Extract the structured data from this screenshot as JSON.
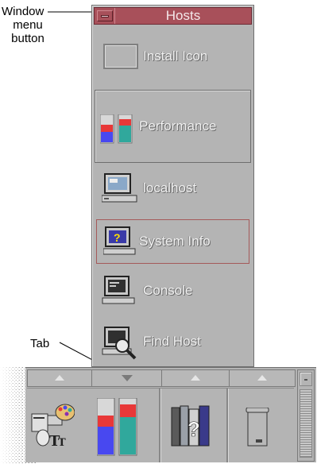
{
  "callouts": {
    "window_menu_button": [
      "Window",
      "menu",
      "button"
    ],
    "tab": "Tab"
  },
  "subpanel": {
    "title": "Hosts",
    "window_menu_icon": "window-menu-button-icon",
    "items": [
      {
        "label": "Install Icon",
        "icon": "install-drop-zone-icon"
      },
      {
        "label": "Performance",
        "icon": "performance-meter-icon"
      },
      {
        "label": "localhost",
        "icon": "workstation-icon"
      },
      {
        "label": "System Info",
        "icon": "system-info-icon"
      },
      {
        "label": "Console",
        "icon": "console-terminal-icon"
      },
      {
        "label": "Find Host",
        "icon": "find-host-magnifier-icon"
      }
    ]
  },
  "front_panel": {
    "tabs": [
      {
        "direction": "up"
      },
      {
        "direction": "down"
      },
      {
        "direction": "up"
      },
      {
        "direction": "up"
      }
    ],
    "controls": [
      {
        "icon": "style-manager-icon"
      },
      {
        "icon": "performance-meter-icon"
      },
      {
        "icon": "help-manager-icon"
      },
      {
        "icon": "trash-can-icon"
      }
    ]
  },
  "colors": {
    "titlebar": "#a8505a",
    "panel": "#b4b4b4",
    "meter_red": "#e83838",
    "meter_blue": "#4848f0",
    "meter_teal": "#30a89c"
  }
}
